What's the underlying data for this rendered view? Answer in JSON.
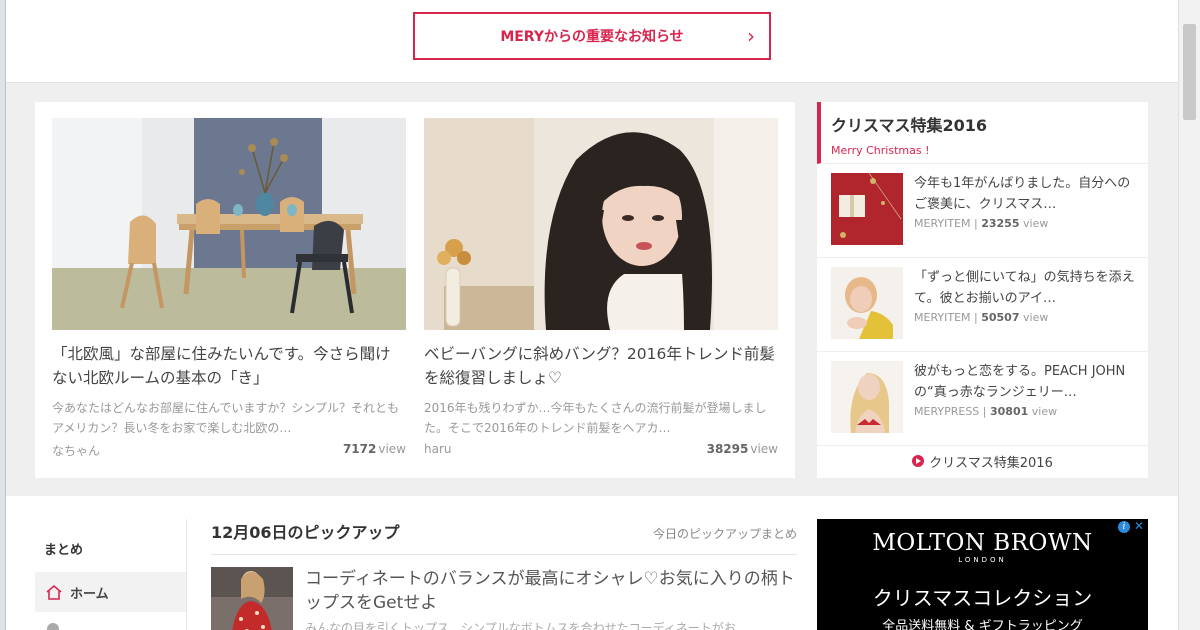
{
  "notice": {
    "label": "MERYからの重要なお知らせ",
    "chevron": "›"
  },
  "features": [
    {
      "title": "「北欧風」な部屋に住みたいんです。今さら聞けない北欧ルームの基本の「き」",
      "excerpt": "今あなたはどんなお部屋に住んでいますか？シンプル？それともアメリカン？長い冬をお家で楽しむ北欧の…",
      "author": "なちゃん",
      "views": "7172",
      "view_unit": "view",
      "thumb_icon": "scandinavian-room-photo"
    },
    {
      "title": "ベビーバングに斜めバング？2016年トレンド前髪を総復習しましょ♡",
      "excerpt": "2016年も残りわずか…今年もたくさんの流行前髪が登場しました。そこで2016年のトレンド前髪をヘアカ…",
      "author": "haru",
      "views": "38295",
      "view_unit": "view",
      "thumb_icon": "bangs-hairstyle-photo"
    }
  ],
  "xmas": {
    "title": "クリスマス特集2016",
    "subtitle": "Merry Christmas !",
    "items": [
      {
        "title": "今年も1年がんばりました。自分へのご褒美に、クリスマス…",
        "source": "MERYITEM",
        "views": "23255",
        "view_unit": "view"
      },
      {
        "title": "「ずっと側にいてね」の気持ちを添えて。彼とお揃いのアイ…",
        "source": "MERYITEM",
        "views": "50507",
        "view_unit": "view"
      },
      {
        "title": "彼がもっと恋をする。PEACH JOHNの“真っ赤なランジェリー…",
        "source": "MERYPRESS",
        "views": "30801",
        "view_unit": "view"
      }
    ],
    "link_label": "クリスマス特集2016"
  },
  "side_nav": {
    "heading": "まとめ",
    "home_label": "ホーム"
  },
  "pickup": {
    "title": "12月06日のピックアップ",
    "more_label": "今日のピックアップまとめ",
    "item_title": "コーディネートのバランスが最高にオシャレ♡お気に入りの柄トップスをGetせよ",
    "item_excerpt": "みんなの目を引くトップス　シンプルなボトムスを合わせたコーディネートがお"
  },
  "ad": {
    "brand": "MOLTON BROWN",
    "city": "LONDON",
    "headline": "クリスマスコレクション",
    "sub": "全品送料無料 & ギフトラッピング",
    "info": "i",
    "close": "✕"
  },
  "colors": {
    "accent": "#d9254e",
    "background": "#efefef"
  }
}
